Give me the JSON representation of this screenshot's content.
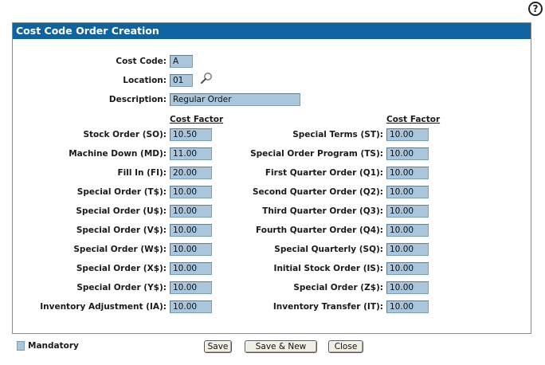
{
  "panel": {
    "title": "Cost Code Order Creation"
  },
  "help": {
    "glyph": "?"
  },
  "header_fields": {
    "cost_code": {
      "label": "Cost Code:",
      "value": "A"
    },
    "location": {
      "label": "Location:",
      "value": "01"
    },
    "description": {
      "label": "Description:",
      "value": "Regular Order"
    }
  },
  "columns": {
    "left_header": "Cost Factor",
    "right_header": "Cost Factor"
  },
  "left_factors": [
    {
      "label": "Stock Order (SO):",
      "value": "10.50"
    },
    {
      "label": "Machine Down (MD):",
      "value": "11.00"
    },
    {
      "label": "Fill In (FI):",
      "value": "20.00"
    },
    {
      "label": "Special Order (T$):",
      "value": "10.00"
    },
    {
      "label": "Special Order (U$):",
      "value": "10.00"
    },
    {
      "label": "Special Order (V$):",
      "value": "10.00"
    },
    {
      "label": "Special Order (W$):",
      "value": "10.00"
    },
    {
      "label": "Special Order (X$):",
      "value": "10.00"
    },
    {
      "label": "Special Order (Y$):",
      "value": "10.00"
    },
    {
      "label": "Inventory Adjustment (IA):",
      "value": "10.00"
    }
  ],
  "right_factors": [
    {
      "label": "Special Terms (ST):",
      "value": "10.00"
    },
    {
      "label": "Special Order Program (TS):",
      "value": "10.00"
    },
    {
      "label": "First Quarter Order (Q1):",
      "value": "10.00"
    },
    {
      "label": "Second Quarter Order (Q2):",
      "value": "10.00"
    },
    {
      "label": "Third Quarter Order (Q3):",
      "value": "10.00"
    },
    {
      "label": "Fourth Quarter Order (Q4):",
      "value": "10.00"
    },
    {
      "label": "Special Quarterly (SQ):",
      "value": "10.00"
    },
    {
      "label": "Initial Stock Order (IS):",
      "value": "10.00"
    },
    {
      "label": "Special Order (Z$):",
      "value": "10.00"
    },
    {
      "label": "Inventory Transfer (IT):",
      "value": "10.00"
    }
  ],
  "legend": {
    "label": "Mandatory"
  },
  "buttons": {
    "save": "Save",
    "save_new": "Save & New",
    "close": "Close"
  },
  "colors": {
    "header_bg": "#0e63a0",
    "mandatory_field": "#a9c6dc"
  },
  "icons": {
    "help": "help-icon",
    "lookup": "magnifier-icon"
  }
}
